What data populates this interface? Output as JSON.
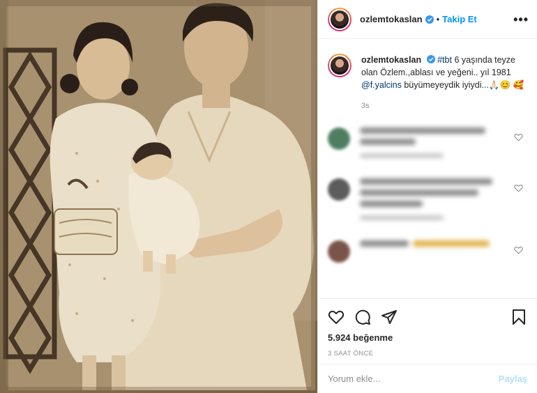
{
  "post": {
    "photo_alt": "",
    "username": "ozlemtokaslan",
    "follow_label": "Takip Et",
    "more_label": "•••"
  },
  "caption": {
    "username": "ozlemtokaslan",
    "hashtag": "#tbt",
    "text_1": " 6 yaşında teyze olan Özlem.,ablası ve yeğeni.. yıl 1981 ",
    "mention": "@f.yalcins",
    "text_2": " büyümeyeydik iyiydi...🙏🏻😊 🥰",
    "time": "3s"
  },
  "stats": {
    "likes": "5.924 beğenme",
    "posted_ago": "3 SAAT ÖNCE"
  },
  "comment_box": {
    "placeholder": "Yorum ekle...",
    "share_label": "Paylaş"
  },
  "colors": {
    "accent": "#0095f6",
    "share_disabled": "#b2dffc",
    "muted": "#8e8e8e",
    "photo_sepia": "#a48c6a"
  },
  "icons": [
    "verified-badge-icon",
    "more-options-icon",
    "heart-icon",
    "comment-icon",
    "share-icon",
    "bookmark-icon"
  ]
}
